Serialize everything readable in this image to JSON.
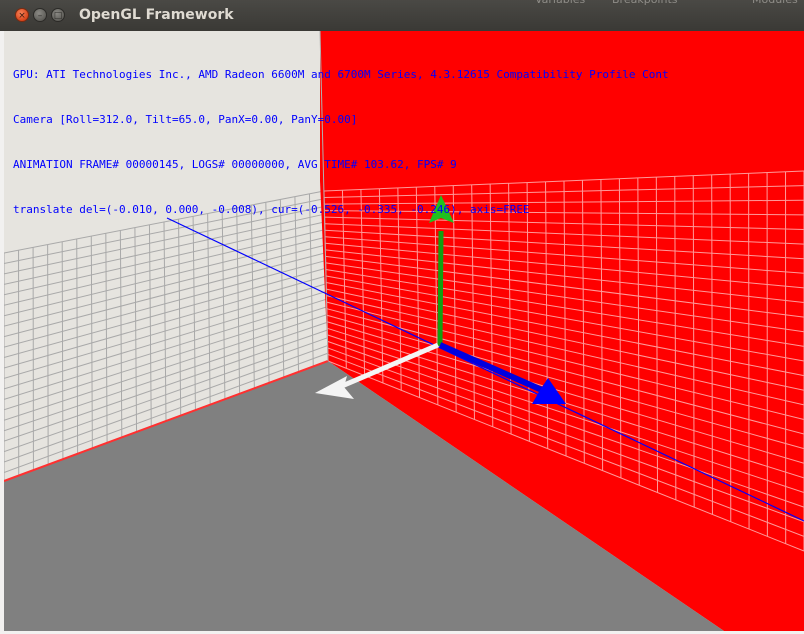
{
  "window": {
    "title": "OpenGL Framework",
    "close_glyph": "×",
    "minimize_glyph": "–",
    "maximize_glyph": "□"
  },
  "background_app": {
    "tab_a": "Variables",
    "tab_b": "Breakpoints",
    "tab_c": "Modules"
  },
  "hud": {
    "line1": "GPU: ATI Technologies Inc., AMD Radeon 6600M and 6700M Series, 4.3.12615 Compatibility Profile Cont",
    "line2": "Camera [Roll=312.0, Tilt=65.0, PanX=0.00, PanY=0.00]",
    "line3": "ANIMATION FRAME# 00000145, LOGS# 00000000, AVG TIME# 103.62, FPS# 9",
    "line4": "translate del=(-0.010, 0.000, -0.008), cur=(-0.526, -0.335, -0.246), axis=FREE"
  },
  "scene": {
    "colors": {
      "red_wall": "#ff0000",
      "floor": "#808080",
      "back_wall": "#e6e4df",
      "grid_on_red": "#ff9a9a",
      "grid_on_light": "#a9a9a9",
      "axis_blue": "#0000ff",
      "axis_green": "#00b000",
      "axis_white": "#ffffff",
      "hud_text": "#0000ff"
    },
    "gizmo": {
      "green_arrow": "y-axis-arrow",
      "blue_arrow": "z-axis-arrow",
      "white_arrow": "x-axis-arrow"
    }
  }
}
